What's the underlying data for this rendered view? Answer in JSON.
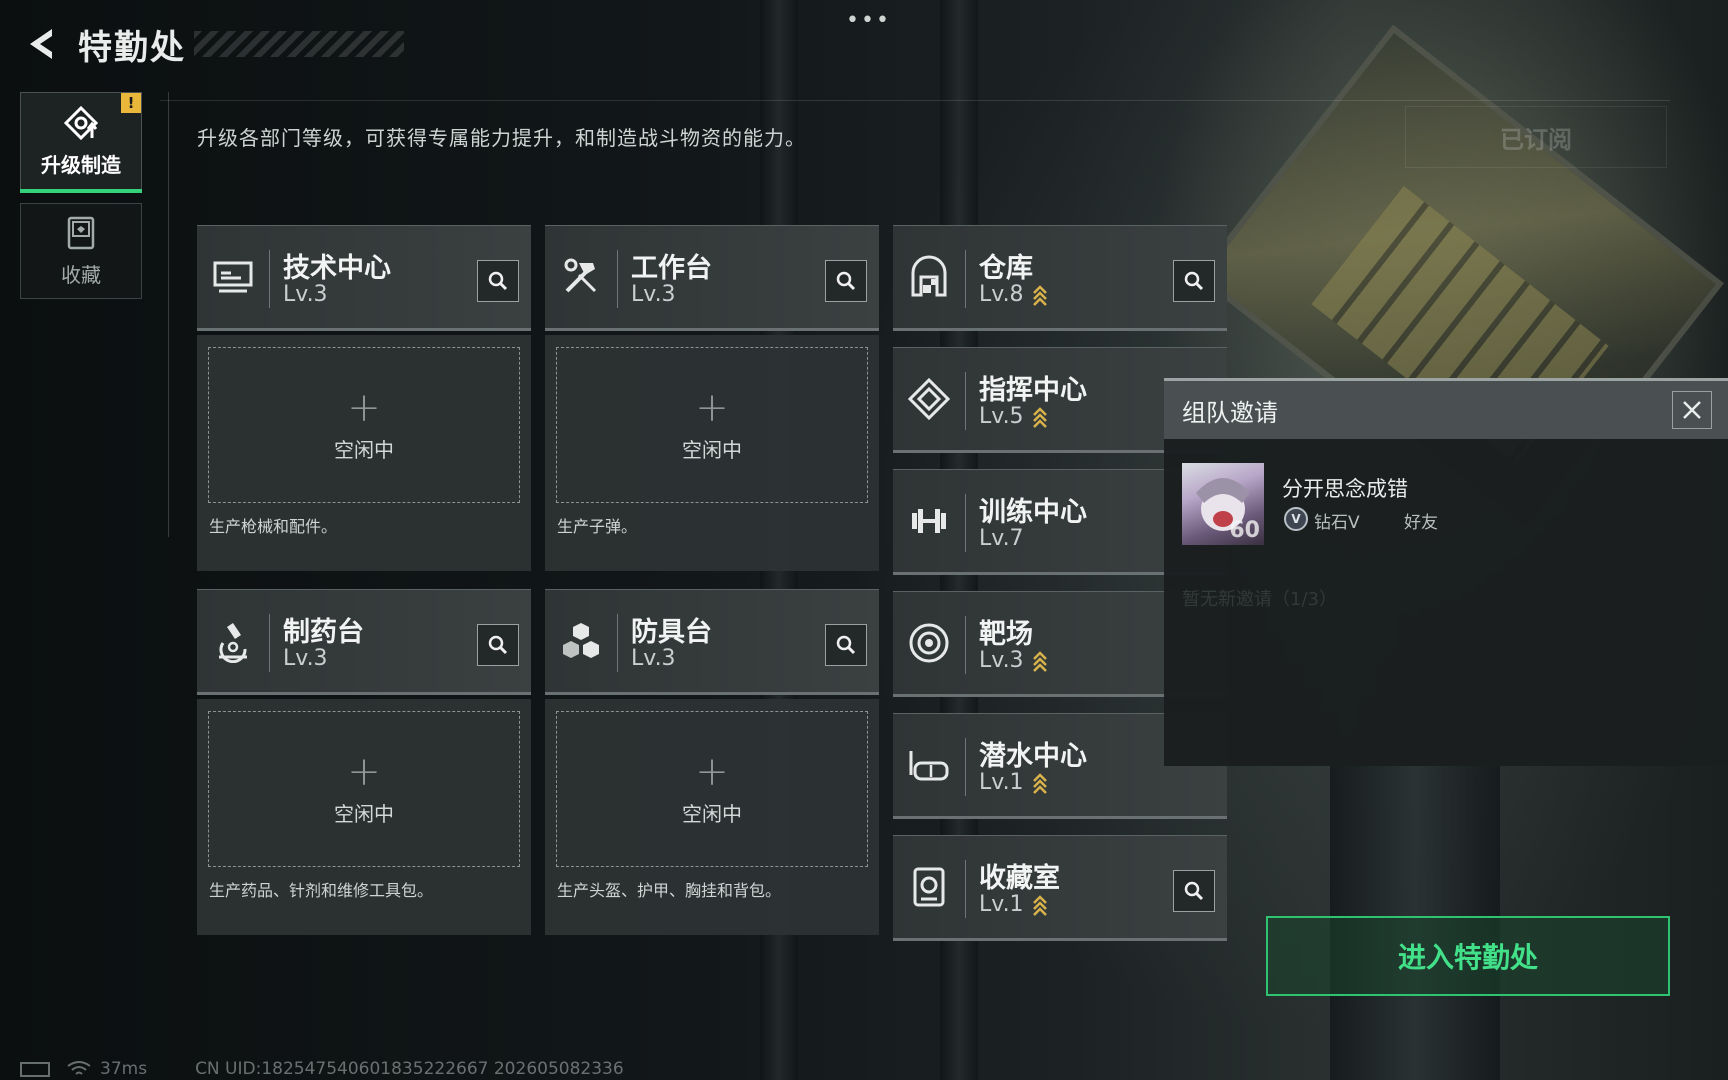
{
  "header": {
    "title": "特勤处"
  },
  "tabs": [
    {
      "label": "升级制造",
      "active": true,
      "alert": "!"
    },
    {
      "label": "收藏",
      "active": false
    }
  ],
  "intro": "升级各部门等级，可获得专属能力提升，和制造战斗物资的能力。",
  "subscribe_label": "已订阅",
  "production_cards": [
    {
      "name": "技术中心",
      "level": "Lv.3",
      "slot_status": "空闲中",
      "desc": "生产枪械和配件。"
    },
    {
      "name": "工作台",
      "level": "Lv.3",
      "slot_status": "空闲中",
      "desc": "生产子弹。"
    },
    {
      "name": "制药台",
      "level": "Lv.3",
      "slot_status": "空闲中",
      "desc": "生产药品、针剂和维修工具包。"
    },
    {
      "name": "防具台",
      "level": "Lv.3",
      "slot_status": "空闲中",
      "desc": "生产头盔、护甲、胸挂和背包。"
    }
  ],
  "facilities": [
    {
      "name": "仓库",
      "level": "Lv.8"
    },
    {
      "name": "指挥中心",
      "level": "Lv.5"
    },
    {
      "name": "训练中心",
      "level": "Lv.7"
    },
    {
      "name": "靶场",
      "level": "Lv.3"
    },
    {
      "name": "潜水中心",
      "level": "Lv.1"
    },
    {
      "name": "收藏室",
      "level": "Lv.1"
    }
  ],
  "invite": {
    "title": "组队邀请",
    "player_name": "分开思念成错",
    "avatar_level": "60",
    "rank_badge": "V",
    "rank": "钻石V",
    "relation": "好友",
    "faded_line": "暂无新邀请（1/3）"
  },
  "enter_button": "进入特勤处",
  "status": {
    "ping": "37ms",
    "uid": "CN UID:18254754060183522266‌7 202605082336"
  },
  "colors": {
    "accent_green": "#35d07a",
    "alert_yellow": "#e9b73a",
    "upgrade_chevron": "#d8b24a"
  }
}
